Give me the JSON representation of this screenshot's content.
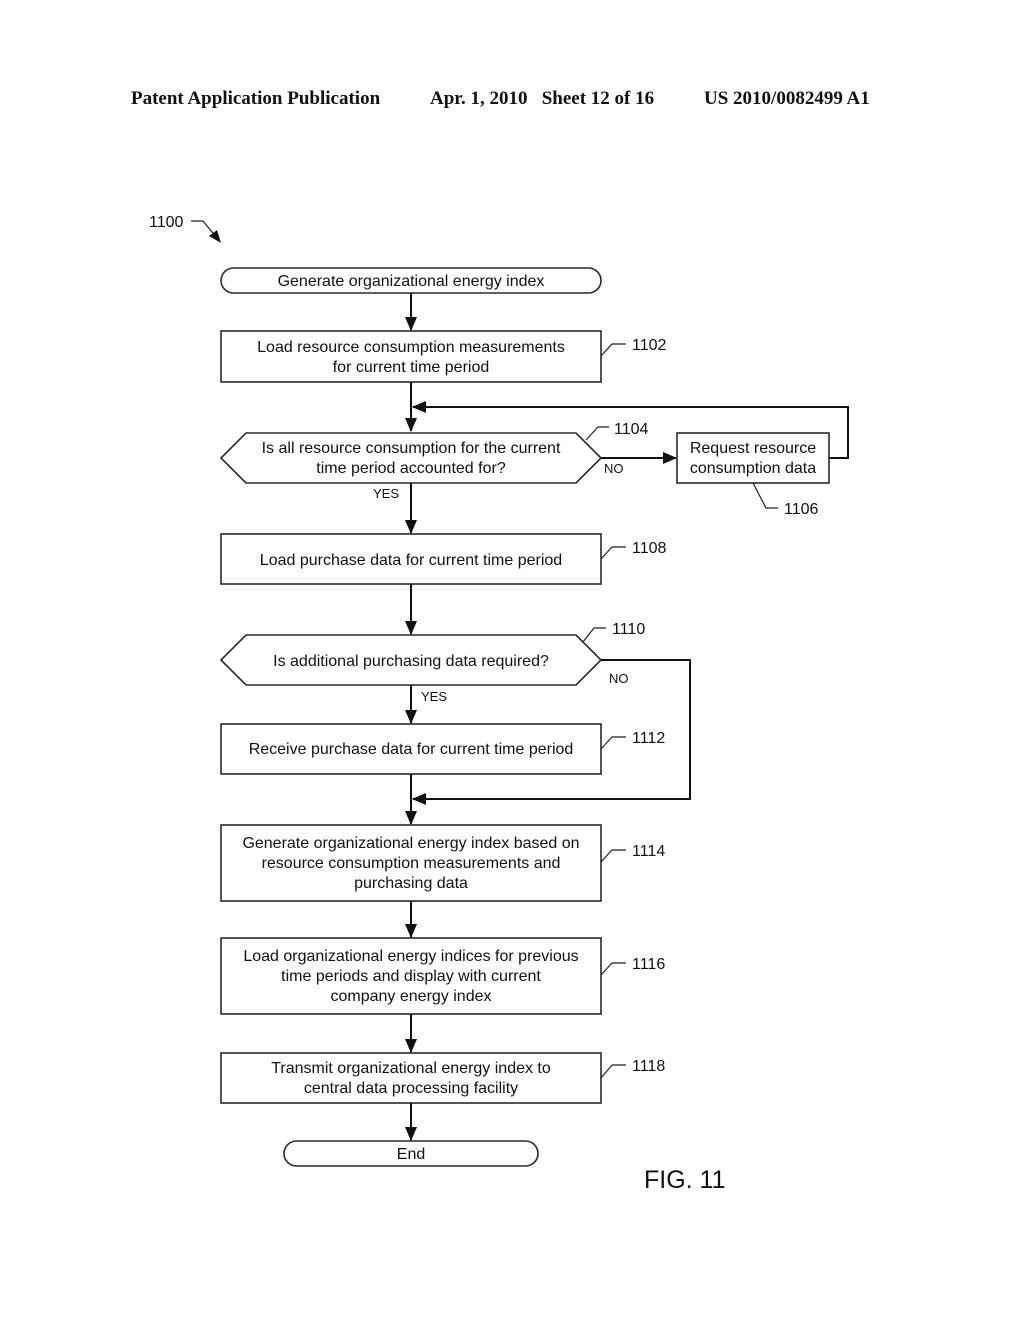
{
  "header": {
    "publication": "Patent Application Publication",
    "date_sheet": "Apr. 1, 2010   Sheet 12 of 16",
    "patent_number": "US 2010/0082499 A1"
  },
  "diagram": {
    "ref": "1100",
    "figure_label": "FIG. 11",
    "start": {
      "text": "Generate organizational energy index"
    },
    "steps": {
      "s1102": {
        "ref": "1102",
        "lines": [
          "Load resource consumption measurements",
          "for current time period"
        ]
      },
      "d1104": {
        "ref": "1104",
        "lines": [
          "Is all resource consumption for the current",
          "time period accounted for?"
        ],
        "yes": "YES",
        "no": "NO"
      },
      "s1106": {
        "ref": "1106",
        "lines": [
          "Request resource",
          "consumption data"
        ]
      },
      "s1108": {
        "ref": "1108",
        "lines": [
          "Load purchase data for current time period"
        ]
      },
      "d1110": {
        "ref": "1110",
        "lines": [
          "Is additional purchasing data required?"
        ],
        "yes": "YES",
        "no": "NO"
      },
      "s1112": {
        "ref": "1112",
        "lines": [
          "Receive purchase data for current time period"
        ]
      },
      "s1114": {
        "ref": "1114",
        "lines": [
          "Generate organizational energy index based on",
          "resource consumption measurements and",
          "purchasing data"
        ]
      },
      "s1116": {
        "ref": "1116",
        "lines": [
          "Load organizational energy indices for previous",
          "time periods and display with current",
          "company energy index"
        ]
      },
      "s1118": {
        "ref": "1118",
        "lines": [
          "Transmit organizational energy index to",
          "central data processing facility"
        ]
      }
    },
    "end": {
      "text": "End"
    }
  }
}
